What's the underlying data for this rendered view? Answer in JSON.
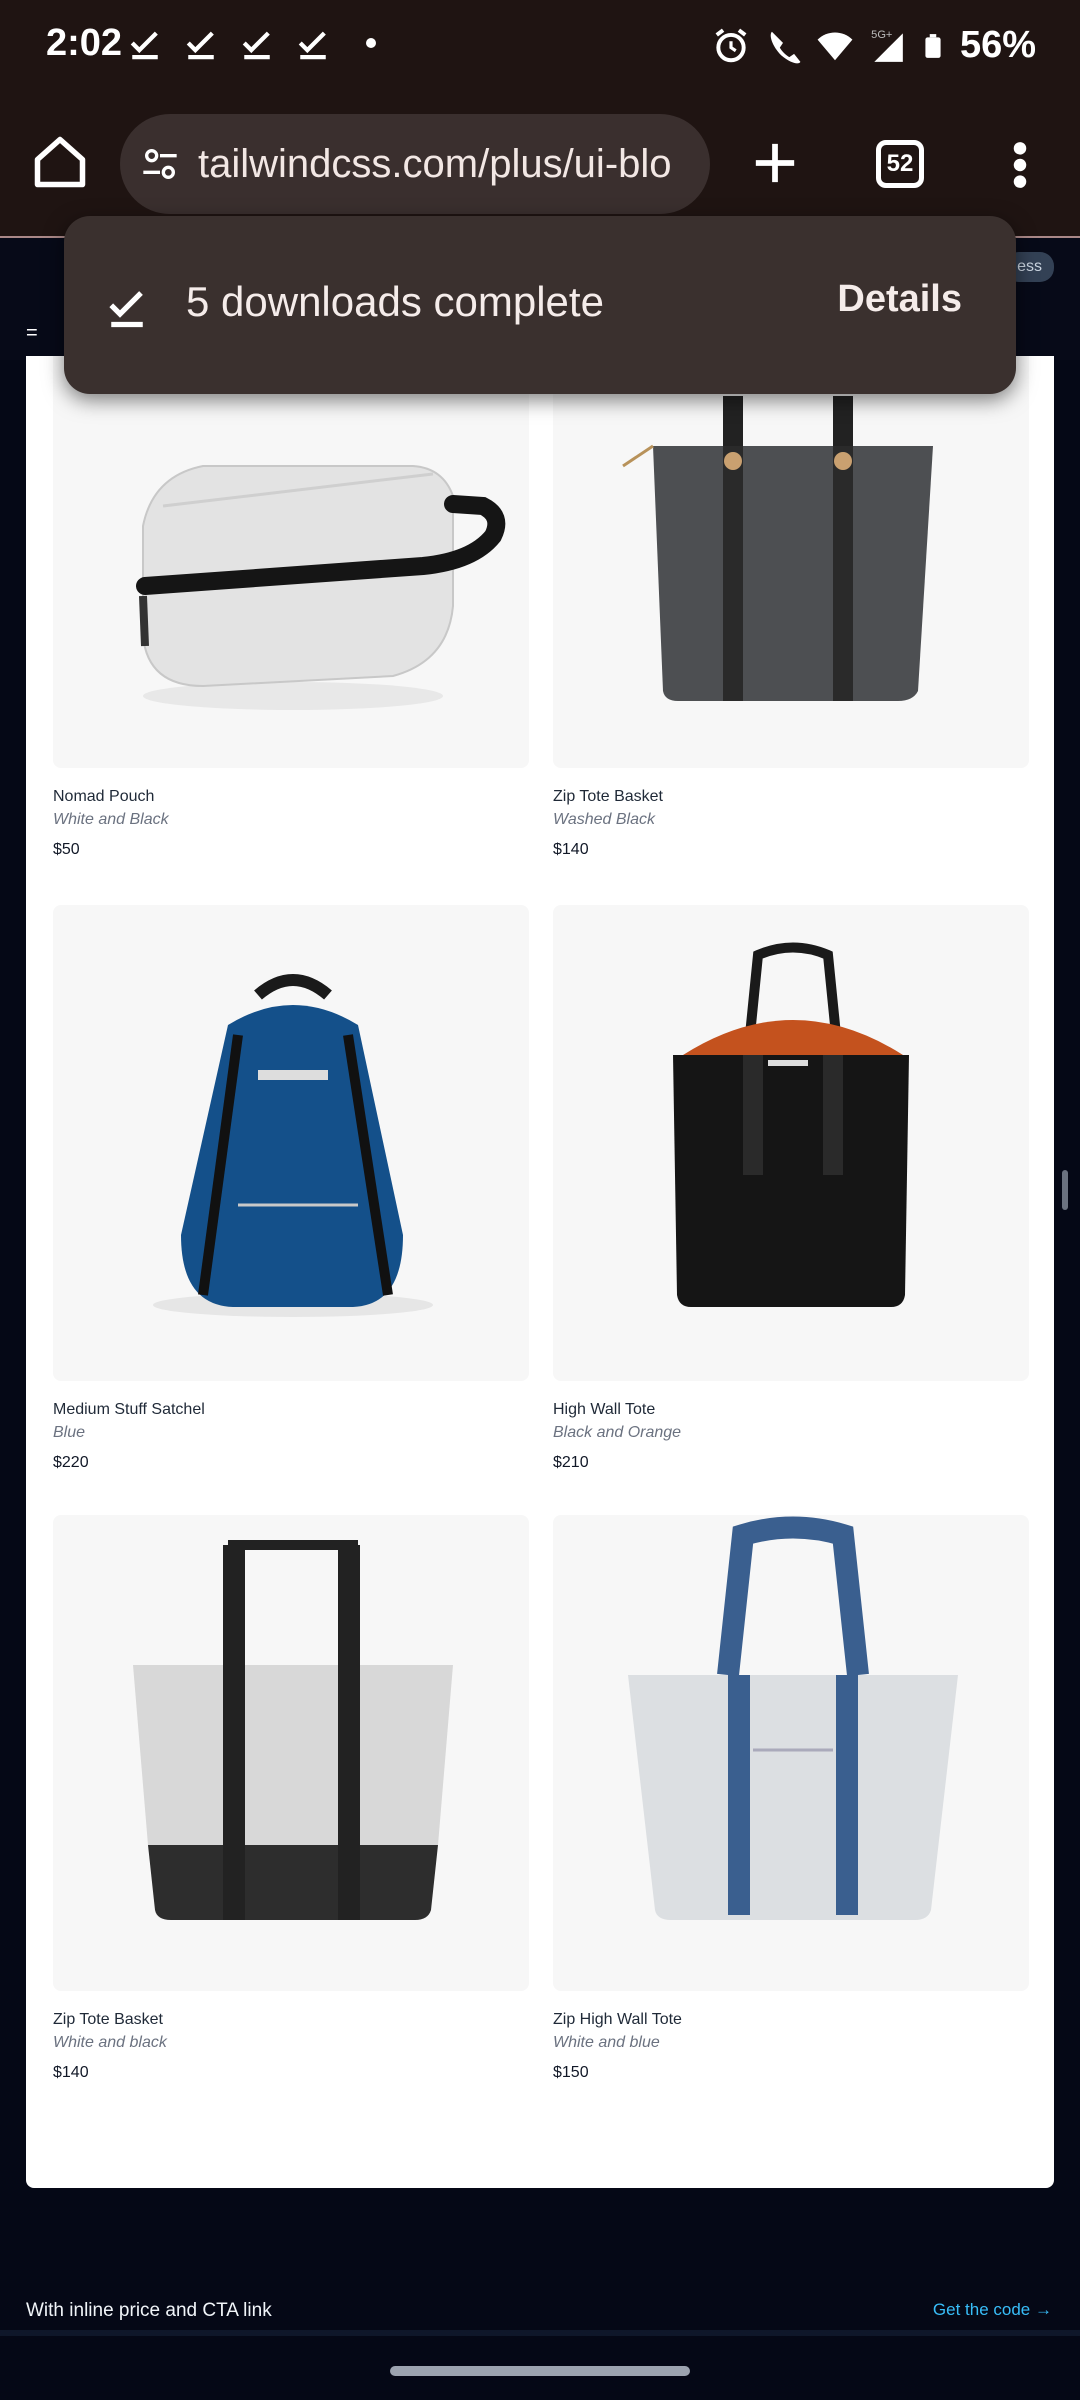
{
  "status_bar": {
    "time": "2:02",
    "battery": "56%",
    "network": "5G+"
  },
  "browser": {
    "url": "tailwindcss.com/plus/ui-blo",
    "tab_count": "52"
  },
  "site": {
    "badge": "ess"
  },
  "snackbar": {
    "message": "5 downloads complete",
    "action": "Details"
  },
  "products": [
    {
      "name": "Nomad Pouch",
      "color": "White and Black",
      "price": "$50",
      "image_icon": "pouch-image"
    },
    {
      "name": "Zip Tote Basket",
      "color": "Washed Black",
      "price": "$140",
      "image_icon": "tote-image"
    },
    {
      "name": "Medium Stuff Satchel",
      "color": "Blue",
      "price": "$220",
      "image_icon": "backpack-image"
    },
    {
      "name": "High Wall Tote",
      "color": "Black and Orange",
      "price": "$210",
      "image_icon": "tote-image"
    },
    {
      "name": "Zip Tote Basket",
      "color": "White and black",
      "price": "$140",
      "image_icon": "tote-image"
    },
    {
      "name": "Zip High Wall Tote",
      "color": "White and blue",
      "price": "$150",
      "image_icon": "tote-image"
    }
  ],
  "footer": {
    "section_title": "With inline price and CTA link",
    "cta": "Get the code →"
  },
  "colors": {
    "chrome": "#1f1412",
    "page_bg": "#050816",
    "accent_link": "#38bdf8"
  }
}
